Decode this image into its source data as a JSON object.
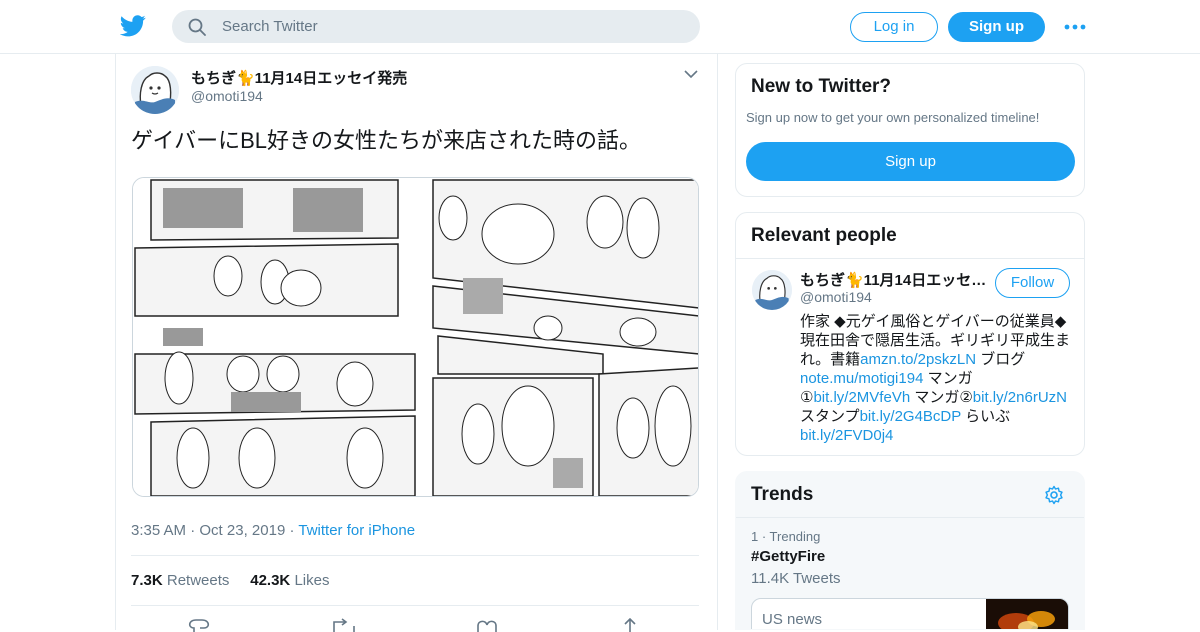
{
  "header": {
    "search_placeholder": "Search Twitter",
    "login_label": "Log in",
    "signup_label": "Sign up",
    "brand_color": "#1da1f2"
  },
  "tweet": {
    "author_name": "もちぎ🐈11月14日エッセイ発売",
    "author_handle": "@omoti194",
    "text": "ゲイバーにBL好きの女性たちが来店された時の話。",
    "time": "3:35 AM",
    "date": "Oct 23, 2019",
    "source": "Twitter for iPhone",
    "retweets_count": "7.3K",
    "retweets_label": "Retweets",
    "likes_count": "42.3K",
    "likes_label": "Likes",
    "icons": [
      "caret-down-icon",
      "reply-icon",
      "retweet-icon",
      "like-icon",
      "share-icon"
    ]
  },
  "new_to_twitter": {
    "title": "New to Twitter?",
    "subtitle": "Sign up now to get your own personalized timeline!",
    "button": "Sign up"
  },
  "relevant_people": {
    "title": "Relevant people",
    "name": "もちぎ🐈11月14日エッセイ発売",
    "handle": "@omoti194",
    "follow": "Follow",
    "bio": {
      "t1": "作家 ◆元ゲイ風俗とゲイバーの従業員◆現在田舎で隠居生活。ギリギリ平成生まれ。書籍",
      "l1": "amzn.to/2pskzLN",
      "t2": " ブログ",
      "l2": "note.mu/motigi194",
      "t3": " マンガ①",
      "l3": "bit.ly/2MVfeVh",
      "t4": " マンガ②",
      "l4": "bit.ly/2n6rUzN",
      "t5": " スタンプ",
      "l5": "bit.ly/2G4BcDP",
      "t6": " らいぶ",
      "l6": "bit.ly/2FVD0j4"
    }
  },
  "trends": {
    "title": "Trends",
    "item_meta": "1 · Trending",
    "item_tag": "#GettyFire",
    "item_count": "11.4K Tweets",
    "news_label": "US news"
  }
}
